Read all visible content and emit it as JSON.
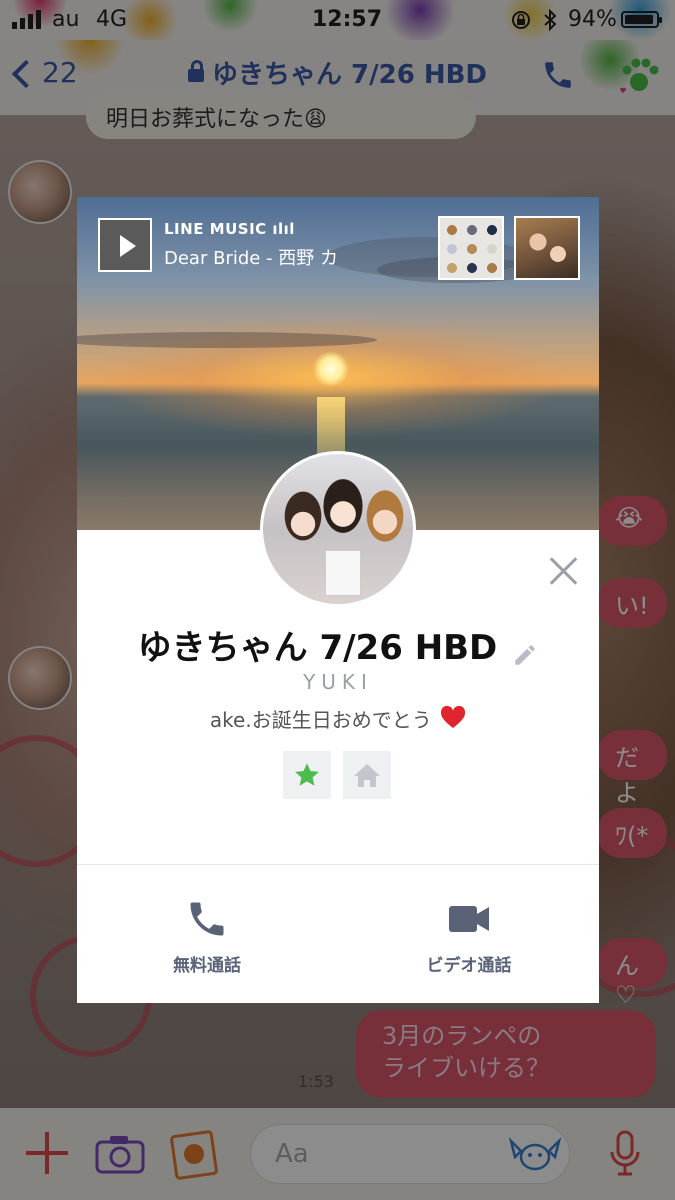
{
  "status_bar": {
    "carrier": "au",
    "network": "4G",
    "time": "12:57",
    "battery": "94%",
    "battery_level": 0.94
  },
  "header": {
    "back_count": "22",
    "title": "ゆきちゃん 7/26 HBD",
    "page_index": 0,
    "page_total": 3
  },
  "chat": {
    "top_bubble": "明日お葬式になった😩",
    "right_bubbles": [
      "😭",
      "い!",
      "だよ",
      "ﾜ(*",
      "ん♡"
    ],
    "big_bubble_line1": "3月のランペの",
    "big_bubble_line2": "ライブいける？",
    "time": "1:53"
  },
  "input_bar": {
    "placeholder": "Aa"
  },
  "profile": {
    "music_label": "LINE MUSIC ılıl",
    "music_song": "Dear Bride - 西野 カ",
    "name": "ゆきちゃん 7/26 HBD",
    "id": "YUKI",
    "status_message": "ake.お誕生日おめでとう",
    "actions": {
      "call": "無料通話",
      "video": "ビデオ通話"
    },
    "accent_color": "#4cbd4c"
  },
  "colors": {
    "link_blue": "#3b5aa8",
    "bubble_pink": "#d9576b",
    "action_gray": "#5a6278"
  }
}
